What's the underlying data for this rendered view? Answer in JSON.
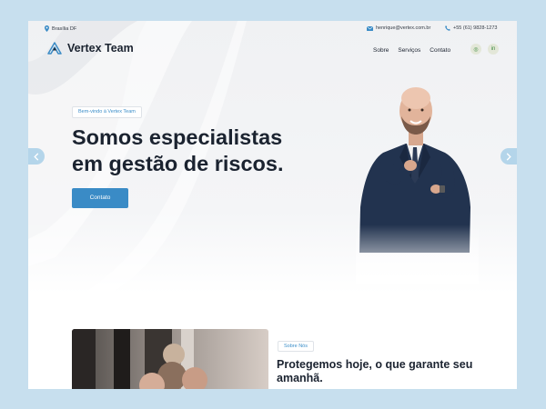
{
  "topbar": {
    "location": "Brasília DF",
    "email": "henrique@vertex.com.br",
    "phone": "+55 (61) 9828-1273"
  },
  "brand": {
    "name": "Vertex Team"
  },
  "nav": {
    "items": [
      "Sobre",
      "Serviços",
      "Contato"
    ]
  },
  "social": [
    {
      "name": "instagram-icon",
      "glyph": "◎"
    },
    {
      "name": "linkedin-icon",
      "glyph": "in"
    }
  ],
  "hero": {
    "badge": "Bem-vindo à Vertex Team",
    "headline_line1": "Somos especialistas",
    "headline_line2": "em gestão de riscos.",
    "cta": "Contato"
  },
  "about": {
    "badge": "Sobre Nós",
    "title": "Protegemos hoje, o que garante seu amanhã."
  },
  "colors": {
    "accent": "#3a8bc6",
    "background": "#c7dfee",
    "text": "#1b2330"
  }
}
